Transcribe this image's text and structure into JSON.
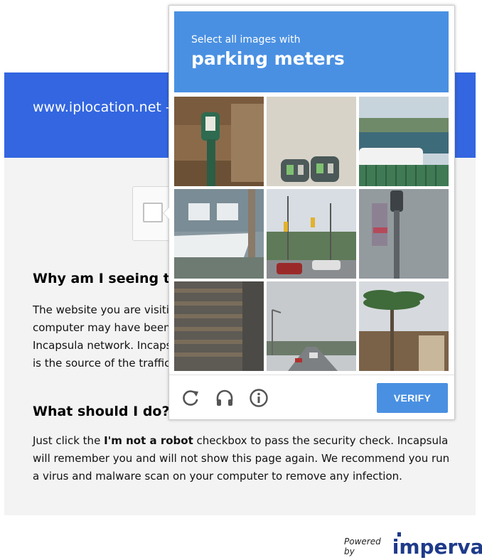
{
  "page": {
    "banner_title": "www.iplocation.net - Additional security check is required",
    "section1": {
      "heading": "Why am I seeing this page?",
      "text": "The website you are visiting is protected and accelerated by Incapsula. Your computer may have been infected by malware and therefore flagged by the Incapsula network. Incapsula displays this page to verify that an actual human is the source of the traffic."
    },
    "section2": {
      "heading": "What should I do?",
      "text_before": "Just click the ",
      "text_bold": "I'm not a robot",
      "text_after": " checkbox to pass the security check. Incapsula will remember you and will not show this page again. We recommend you run a virus and malware scan on your computer to remove any infection."
    },
    "footer": {
      "powered_by": "Powered by",
      "logo": "imperva"
    }
  },
  "captcha": {
    "prompt_small": "Select all images with",
    "prompt_big": "parking meters",
    "tiles": [
      {
        "name": "tile-1"
      },
      {
        "name": "tile-2"
      },
      {
        "name": "tile-3"
      },
      {
        "name": "tile-4"
      },
      {
        "name": "tile-5"
      },
      {
        "name": "tile-6"
      },
      {
        "name": "tile-7"
      },
      {
        "name": "tile-8"
      },
      {
        "name": "tile-9"
      }
    ],
    "toolbar": {
      "reload_icon": "reload-icon",
      "audio_icon": "headphones-icon",
      "info_icon": "info-icon",
      "verify_label": "VERIFY"
    },
    "colors": {
      "prompt_bg": "#4a90e2",
      "verify_bg": "#4a90e2",
      "banner_bg": "#3366e0"
    }
  }
}
